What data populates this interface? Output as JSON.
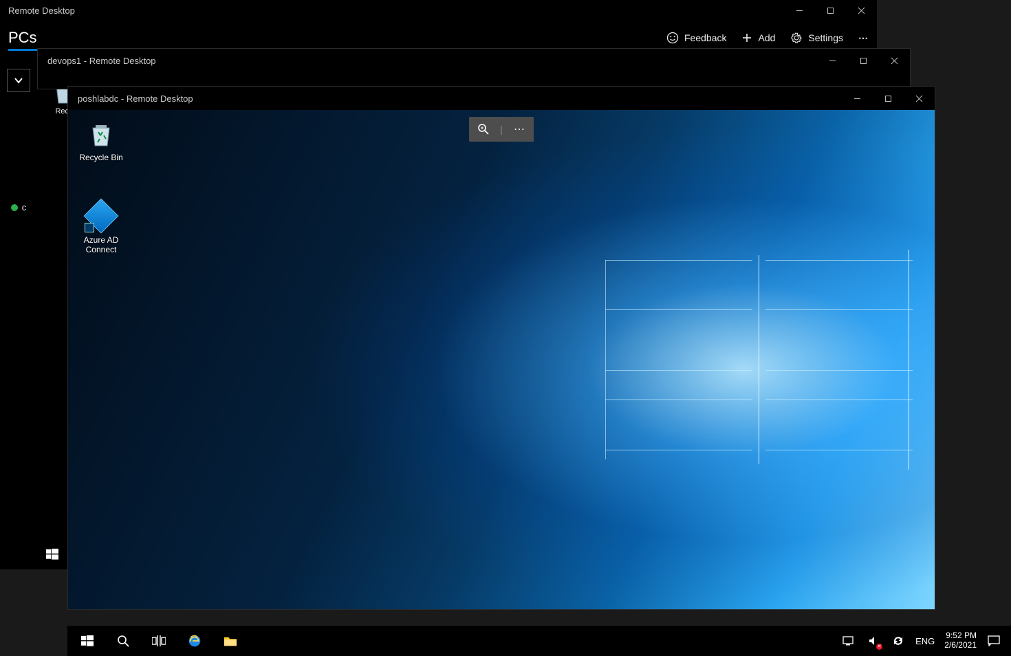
{
  "app": {
    "title": "Remote Desktop",
    "tab_pcs": "PCs",
    "header_actions": {
      "feedback": "Feedback",
      "add": "Add",
      "settings": "Settings"
    },
    "side_status_letter": "c"
  },
  "windows": {
    "devops1": {
      "title": "devops1 - Remote Desktop"
    },
    "poshlabdc": {
      "title": "poshlabdc - Remote Desktop"
    }
  },
  "desktop_icons": {
    "recycle_outer": "Recycle",
    "recycle": "Recycle Bin",
    "aad_line1": "Azure AD",
    "aad_line2": "Connect"
  },
  "taskbar": {
    "lang": "ENG",
    "time": "9:52 PM",
    "date": "2/6/2021"
  }
}
